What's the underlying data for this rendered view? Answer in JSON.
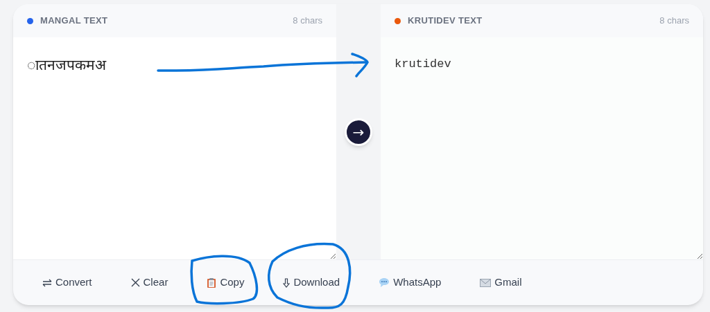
{
  "panels": [
    {
      "title": "MANGAL TEXT",
      "color": "#2563eb",
      "count": "8 chars",
      "value": "ातनजपकमअ",
      "kind": "input"
    },
    {
      "title": "KRUTIDEV TEXT",
      "color": "#ea580c",
      "count": "8 chars",
      "value": "krutidev",
      "kind": "output"
    }
  ],
  "convert_arrow": "→",
  "actions": [
    {
      "label": "Convert",
      "kind": "swap"
    },
    {
      "label": "Clear",
      "kind": "close"
    },
    {
      "label": "Copy",
      "kind": "clipboard"
    },
    {
      "label": "Download",
      "kind": "download"
    },
    {
      "label": "WhatsApp",
      "kind": "chat"
    },
    {
      "label": "Gmail",
      "kind": "mail"
    }
  ]
}
